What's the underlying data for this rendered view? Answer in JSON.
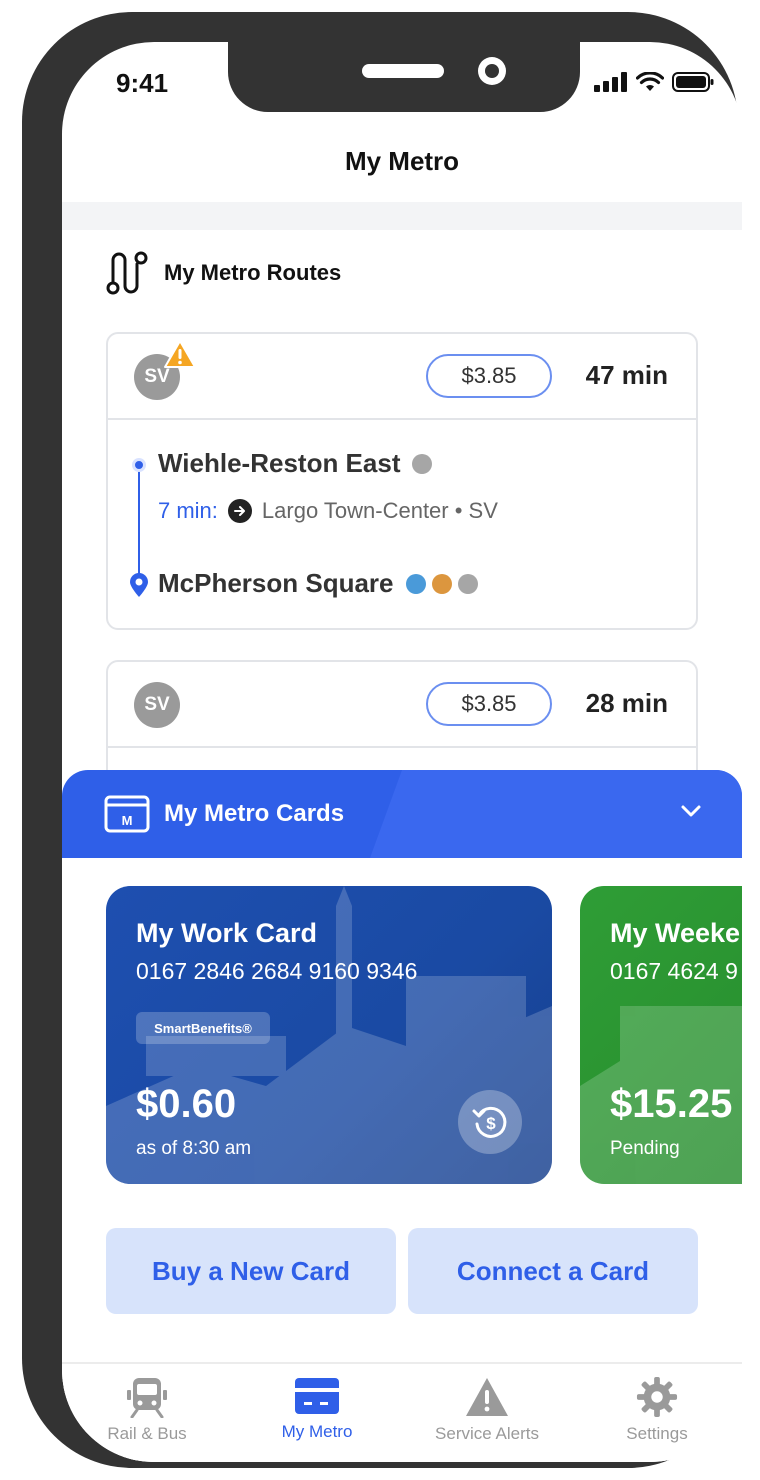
{
  "status_bar": {
    "time": "9:41"
  },
  "nav": {
    "title": "My Metro"
  },
  "routes_section": {
    "title": "My Metro Routes"
  },
  "routes": [
    {
      "line_code": "SV",
      "has_alert": true,
      "fare": "$3.85",
      "duration": "47 min",
      "origin": {
        "name": "Wiehle-Reston East",
        "line_colors": [
          "#a6a6a6"
        ]
      },
      "transfer": {
        "minutes": "7 min:",
        "direction": "Largo Town-Center • SV"
      },
      "destination": {
        "name": "McPherson Square",
        "line_colors": [
          "#4a9ad9",
          "#dc963e",
          "#a6a6a6"
        ]
      }
    },
    {
      "line_code": "SV",
      "has_alert": false,
      "fare": "$3.85",
      "duration": "28 min"
    }
  ],
  "cards_panel": {
    "title": "My Metro Cards"
  },
  "metro_cards": [
    {
      "name": "My Work Card",
      "number": "0167 2846 2684 9160 9346",
      "benefit": "SmartBenefits®",
      "balance": "$0.60",
      "status": "as of 8:30 am",
      "color": "#1e4fb0"
    },
    {
      "name": "My Weeke",
      "number": "0167 4624 9",
      "balance": "$15.25",
      "status": "Pending",
      "color": "#2f9d36"
    }
  ],
  "actions": {
    "buy": "Buy a New Card",
    "connect": "Connect a Card"
  },
  "tabs": [
    {
      "label": "Rail & Bus",
      "icon": "train-icon",
      "active": false
    },
    {
      "label": "My Metro",
      "icon": "card-icon",
      "active": true
    },
    {
      "label": "Service Alerts",
      "icon": "warning-icon",
      "active": false
    },
    {
      "label": "Settings",
      "icon": "gear-icon",
      "active": false
    }
  ],
  "colors": {
    "accent": "#2f5fe8",
    "alert": "#f5a623"
  }
}
